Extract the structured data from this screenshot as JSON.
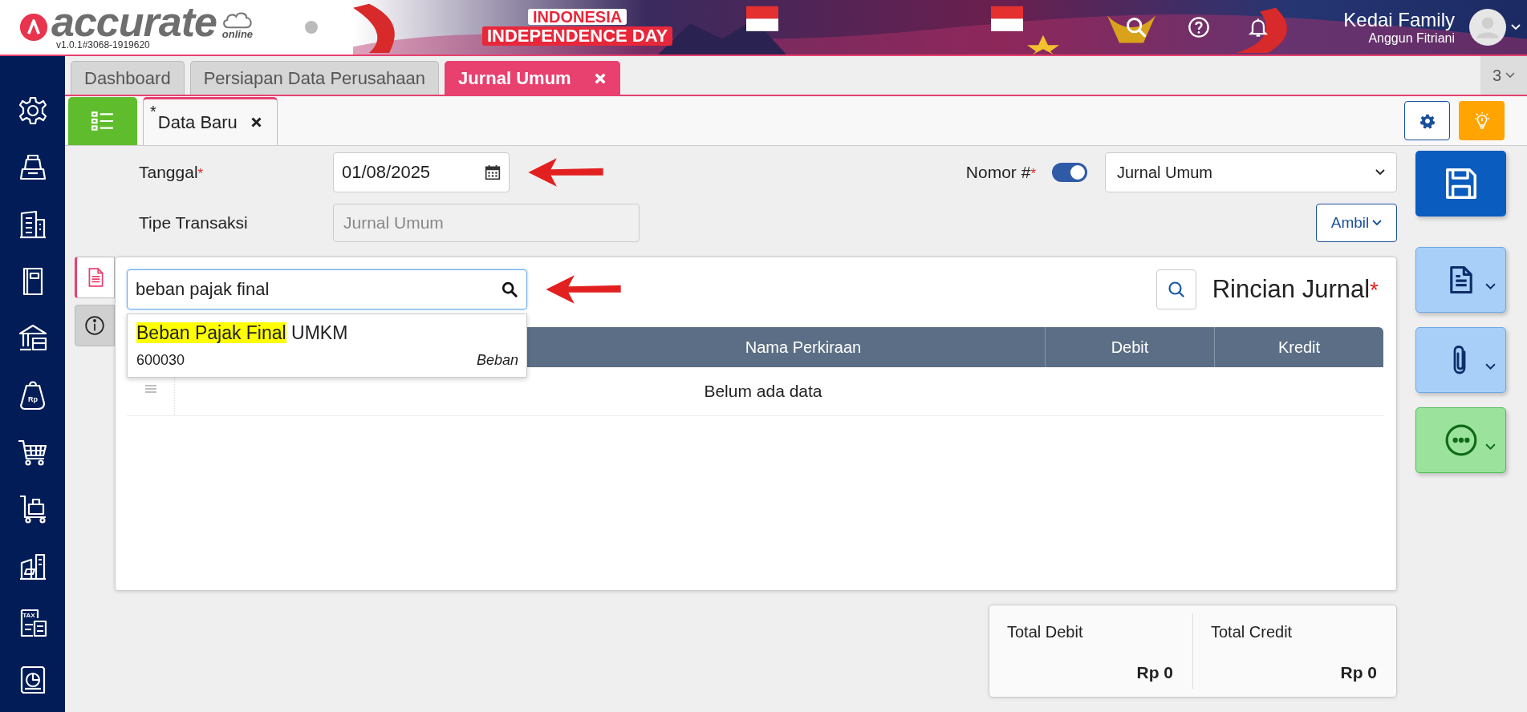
{
  "header": {
    "logo": {
      "name": "accurate",
      "sub": "online",
      "version": "v1.0.1#3068-1919620"
    },
    "banner": {
      "line_1": "INDONESIA",
      "line_2": "INDEPENDENCE DAY"
    },
    "actions": [
      {
        "kind": "search"
      },
      {
        "kind": "help"
      },
      {
        "kind": "bell"
      }
    ],
    "user": {
      "company": "Kedai Family",
      "name": "Anggun Fitriani"
    }
  },
  "sidebar": {
    "items": [
      {
        "kind": "gear"
      },
      {
        "kind": "register"
      },
      {
        "kind": "building"
      },
      {
        "kind": "book"
      },
      {
        "kind": "bank"
      },
      {
        "kind": "tag",
        "label": "Rp"
      },
      {
        "kind": "cart"
      },
      {
        "kind": "trolley"
      },
      {
        "kind": "factory"
      },
      {
        "kind": "tax",
        "label": "TAX"
      },
      {
        "kind": "report"
      }
    ]
  },
  "tabs": [
    {
      "label": "Dashboard",
      "selected": false,
      "closable": false
    },
    {
      "label": "Persiapan Data Perusahaan",
      "selected": false,
      "closable": false
    },
    {
      "label": "Jurnal Umum",
      "selected": true,
      "closable": true
    }
  ],
  "tab_count": "3",
  "subtabs": [
    {
      "label": "Data Baru",
      "mark": "*",
      "selected": true
    }
  ],
  "form": {
    "tanggal": {
      "label": "Tanggal",
      "mark": "*",
      "value": "01/08/2025"
    },
    "nomor": {
      "label": "Nomor #",
      "mark": "*",
      "auto": true,
      "value": "Jurnal Umum"
    },
    "tipe": {
      "label": "Tipe Transaksi",
      "value": "Jurnal Umum",
      "disabled": true
    },
    "ambil": "Ambil"
  },
  "side_tabs": [
    {
      "kind": "detail",
      "selected": true
    },
    {
      "kind": "info",
      "selected": false
    }
  ],
  "detail": {
    "search": {
      "value": "beban pajak final"
    },
    "suggestions": [
      {
        "highlight": "Beban Pajak Final",
        "rest": " UMKM",
        "code": "600030",
        "type": "Beban"
      }
    ],
    "title": "Rincian Jurnal",
    "mark": "*",
    "table": {
      "columns": [
        "Nama Perkiraan",
        "Debit",
        "Kredit"
      ],
      "empty": "Belum ada data"
    }
  },
  "totals": [
    {
      "label": "Total Debit",
      "value": "Rp 0"
    },
    {
      "label": "Total Credit",
      "value": "Rp 0"
    }
  ]
}
